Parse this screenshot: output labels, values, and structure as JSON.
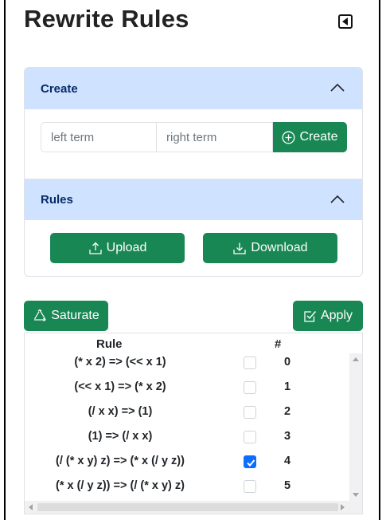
{
  "page": {
    "title": "Rewrite Rules"
  },
  "colors": {
    "accent": "#198754",
    "header_bg": "#cfe2ff",
    "header_text": "#052c65",
    "checkbox_on": "#0d6efd"
  },
  "create_section": {
    "header": "Create",
    "left_placeholder": "left term",
    "right_placeholder": "right term",
    "button_label": "Create",
    "button_icon": "plus-circle-icon"
  },
  "rules_section": {
    "header": "Rules",
    "upload_label": "Upload",
    "upload_icon": "upload-icon",
    "download_label": "Download",
    "download_icon": "download-icon"
  },
  "actions": {
    "saturate_label": "Saturate",
    "saturate_icon": "recycle-icon",
    "apply_label": "Apply",
    "apply_icon": "check-square-icon"
  },
  "table": {
    "columns": [
      "Rule",
      "#"
    ],
    "rows": [
      {
        "rule": "(* x 2) => (<< x 1)",
        "checked": false,
        "num": "0"
      },
      {
        "rule": "(<< x 1) => (* x 2)",
        "checked": false,
        "num": "1"
      },
      {
        "rule": "(/ x x) => (1)",
        "checked": false,
        "num": "2"
      },
      {
        "rule": "(1) => (/ x x)",
        "checked": false,
        "num": "3"
      },
      {
        "rule": "(/ (* x y) z) => (* x (/ y z))",
        "checked": true,
        "num": "4"
      },
      {
        "rule": "(* x (/ y z)) => (/ (* x y) z)",
        "checked": false,
        "num": "5"
      }
    ]
  }
}
